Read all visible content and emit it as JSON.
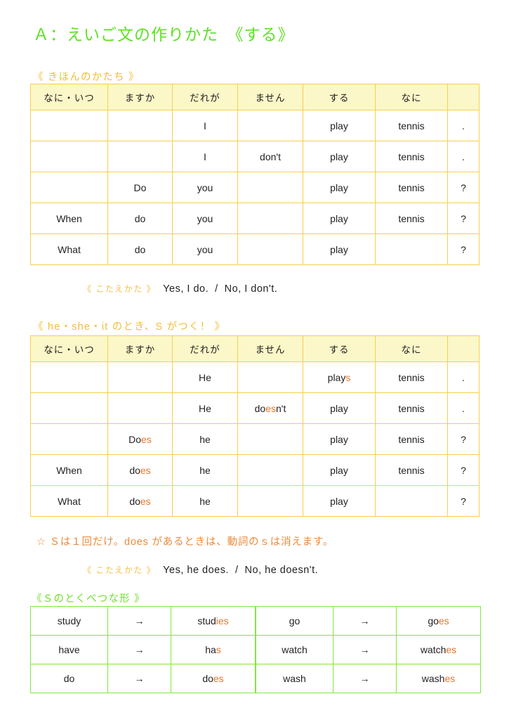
{
  "title": "Ａ：えいご文の作りかた　《する》",
  "colors": {
    "title_green": "#5ee226",
    "header_amber": "#f6bd3b",
    "border_yellow": "#f7cf4e",
    "header_fill": "#fbf7c8",
    "border_green": "#7ee83f",
    "highlight_orange": "#e8762a",
    "note_orange": "#ec8b3c",
    "text_black": "#231f20"
  },
  "section1": {
    "heading": "《 きほんのかたち 》",
    "table": {
      "columns": [
        "なに・いつ",
        "ますか",
        "だれが",
        "ません",
        "する",
        "なに",
        ""
      ],
      "rows": [
        [
          "",
          "",
          "I",
          "",
          "play",
          "tennis",
          "."
        ],
        [
          "",
          "",
          "I",
          "don't",
          "play",
          "tennis",
          "."
        ],
        [
          "",
          "Do",
          "you",
          "",
          "play",
          "tennis",
          "?"
        ],
        [
          "When",
          "do",
          "you",
          "",
          "play",
          "tennis",
          "?"
        ],
        [
          "What",
          "do",
          "you",
          "",
          "play",
          "",
          "?"
        ]
      ]
    },
    "answer": {
      "label": "《 こたえかた 》",
      "affirmative": "Yes, I do.",
      "separator": "/",
      "negative": "No, I don't."
    }
  },
  "section2": {
    "heading": "《 he・she・it のとき、S がつく！ 》",
    "table": {
      "columns": [
        "なに・いつ",
        "ますか",
        "だれが",
        "ません",
        "する",
        "なに",
        ""
      ],
      "rows": [
        [
          "",
          "",
          "He",
          "",
          "play|s",
          "tennis",
          "."
        ],
        [
          "",
          "",
          "He",
          "do|es|n't",
          "play",
          "tennis",
          "."
        ],
        [
          "",
          "Do|es",
          "he",
          "",
          "play",
          "tennis",
          "?"
        ],
        [
          "When",
          "do|es",
          "he",
          "",
          "play",
          "tennis",
          "?"
        ],
        [
          "What",
          "do|es",
          "he",
          "",
          "play",
          "",
          "?"
        ]
      ]
    },
    "note": "☆ Ｓは１回だけ。does があるときは、動詞のｓは消えます。",
    "answer": {
      "label": "《 こたえかた 》",
      "affirmative": "Yes, he does.",
      "separator": "/",
      "negative": "No, he doesn't."
    }
  },
  "section3": {
    "heading": "《Ｓのとくべつな形 》",
    "arrow": "→",
    "left_rows": [
      {
        "base": "study",
        "result": "stud|ies"
      },
      {
        "base": "have",
        "result": "ha|s"
      },
      {
        "base": "do",
        "result": "do|es"
      }
    ],
    "right_rows": [
      {
        "base": "go",
        "result": "go|es"
      },
      {
        "base": "watch",
        "result": "watch|es"
      },
      {
        "base": "wash",
        "result": "wash|es"
      }
    ]
  }
}
